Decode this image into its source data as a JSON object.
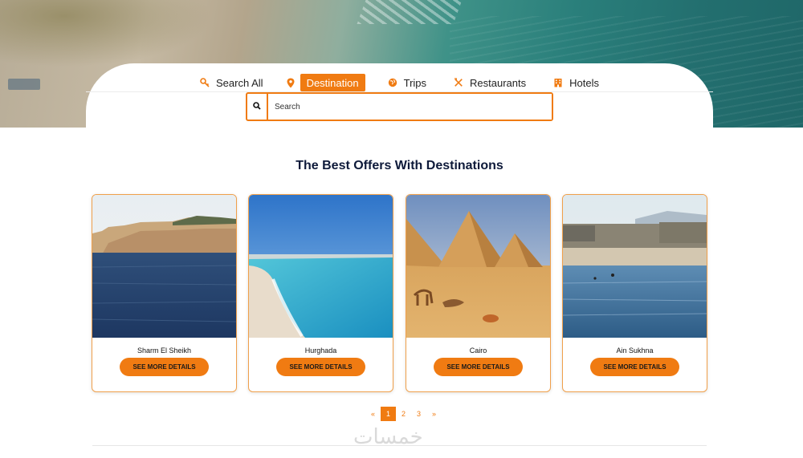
{
  "search_tabs": [
    {
      "label": "Search All",
      "icon": "key-search-icon"
    },
    {
      "label": "Destination",
      "icon": "map-pin-icon",
      "active": true
    },
    {
      "label": "Trips",
      "icon": "globe-icon"
    },
    {
      "label": "Restaurants",
      "icon": "cutlery-icon"
    },
    {
      "label": "Hotels",
      "icon": "hotel-icon"
    }
  ],
  "search": {
    "placeholder": "Search"
  },
  "section_title": "The Best Offers With Destinations",
  "destinations": [
    {
      "name": "Sharm El Sheikh",
      "button": "SEE MORE DETAILS"
    },
    {
      "name": "Hurghada",
      "button": "SEE MORE DETAILS"
    },
    {
      "name": "Cairo",
      "button": "SEE MORE DETAILS"
    },
    {
      "name": "Ain Sukhna",
      "button": "SEE MORE DETAILS"
    }
  ],
  "pagination": {
    "prev": "«",
    "pages": [
      "1",
      "2",
      "3"
    ],
    "current": "1",
    "next": "»"
  },
  "watermark": "خمسات",
  "colors": {
    "accent": "#f07b12",
    "title": "#0e1a3a",
    "card_border": "#f0a04b"
  }
}
